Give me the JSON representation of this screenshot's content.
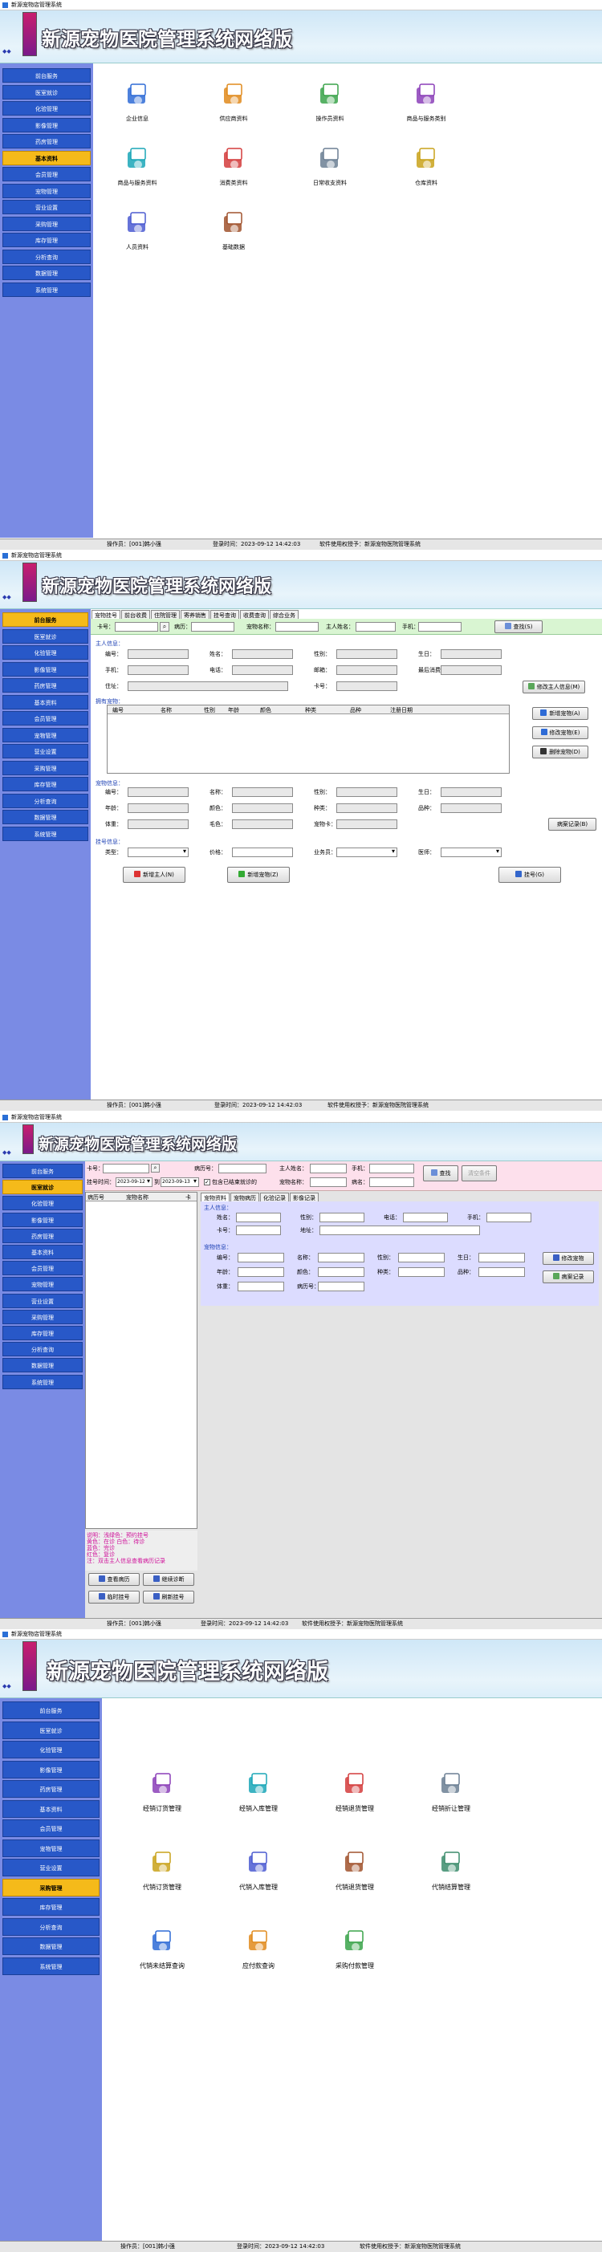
{
  "app": {
    "window_title": "新源宠物店管理系统",
    "banner_title": "新源宠物医院管理系统网络版",
    "banner_mini": "◆◆"
  },
  "status": {
    "operator": "操作员：[001]韩小强",
    "login_time": "登录时间：2023-09-12 14:42:03",
    "licensee": "软件使用权授予：新源宠物医院管理系统"
  },
  "menu": [
    "前台服务",
    "医室就诊",
    "化验管理",
    "影像管理",
    "药房管理",
    "基本资料",
    "会员管理",
    "宠物管理",
    "营业设置",
    "采购管理",
    "库存管理",
    "分析查询",
    "数据管理",
    "系统管理"
  ],
  "panel1": {
    "active_menu": "基本资料",
    "tiles": [
      {
        "label": "企业信息",
        "icon": "company-info-icon"
      },
      {
        "label": "供应商资料",
        "icon": "supplier-icon"
      },
      {
        "label": "操作员资料",
        "icon": "operator-icon"
      },
      {
        "label": "商品与服务类别",
        "icon": "category-icon"
      },
      {
        "label": "商品与服务资料",
        "icon": "goods-icon"
      },
      {
        "label": "消费类资料",
        "icon": "consumption-icon"
      },
      {
        "label": "日常收支资料",
        "icon": "income-expense-icon"
      },
      {
        "label": "仓库资料",
        "icon": "warehouse-icon"
      },
      {
        "label": "人员资料",
        "icon": "staff-icon"
      },
      {
        "label": "基础数据",
        "icon": "base-data-icon"
      }
    ]
  },
  "panel2": {
    "active_menu": "前台服务",
    "tabs": [
      "宠物挂号",
      "前台收费",
      "住院管理",
      "寄养销售",
      "挂号查询",
      "收费查询",
      "综合业务"
    ],
    "search": {
      "card_label": "卡号：",
      "pet_no_label": "病历：",
      "pet_name_label": "宠物名称：",
      "owner_label": "主人姓名：",
      "phone_label": "手机：",
      "search_btn": "查找(S)"
    },
    "owner_section": "主人信息：",
    "owner_fields": [
      [
        "编号：",
        "姓名：",
        "性别：",
        "生日："
      ],
      [
        "手机：",
        "电话：",
        "邮箱：",
        "最后消费："
      ],
      [
        "住址：",
        "",
        "卡号："
      ]
    ],
    "modify_owner_btn": "修改主人信息(M)",
    "pets_section": "拥有宠物：",
    "pets_columns": [
      "编号",
      "名称",
      "性别",
      "年龄",
      "颜色",
      "种类",
      "品种",
      "注册日期"
    ],
    "pet_buttons": [
      "新增宠物(A)",
      "修改宠物(E)",
      "删除宠物(D)"
    ],
    "pet_section": "宠物信息：",
    "pet_fields": [
      [
        "编号：",
        "名称：",
        "性别：",
        "生日："
      ],
      [
        "年龄：",
        "颜色：",
        "种类：",
        "品种："
      ],
      [
        "体重：",
        "毛色：",
        "宠物卡："
      ]
    ],
    "medical_btn": "病案记录(B)",
    "reg_section": "挂号信息：",
    "reg_fields": [
      "类型：",
      "价格：",
      "业务员：",
      "医师："
    ],
    "bottom_buttons": [
      "新增主人(N)",
      "新增宠物(Z)",
      "挂号(G)"
    ]
  },
  "panel3": {
    "active_menu": "医室就诊",
    "row1": {
      "card": "卡号：",
      "pet_no": "病历号：",
      "owner": "主人姓名：",
      "phone": "手机：",
      "search_btn": "查找",
      "extra_btn": "清空条件"
    },
    "row2": {
      "date_label": "挂号时间：",
      "date_from": "2023-09-12",
      "to": "到",
      "date_to": "2023-09-13",
      "include": "包含已结束就诊的",
      "pet_name": "宠物名称：",
      "vip": "病名："
    },
    "list_columns": [
      "病历号",
      "宠物名称",
      "卡"
    ],
    "legend_lines": [
      "说明：浅绿色：预约挂号",
      "黄色：在诊    白色：待诊",
      "蓝色：完诊",
      "红色：复诊",
      "注：双击主人信息查看病历记录"
    ],
    "left_buttons": [
      "查看病历",
      "继续诊断",
      "临时挂号",
      "刷新挂号"
    ],
    "tabs": [
      "宠物资料",
      "宠物病历",
      "化验记录",
      "影像记录"
    ],
    "owner_section": "主人信息：",
    "owner_fields": [
      "姓名：",
      "性别：",
      "电话：",
      "手机：",
      "卡号：",
      "地址："
    ],
    "pet_section": "宠物信息：",
    "pet_fields": [
      [
        "编号：",
        "名称：",
        "性别：",
        "生日："
      ],
      [
        "年龄：",
        "颜色：",
        "种类：",
        "品种："
      ],
      [
        "体重：",
        "病历号："
      ]
    ],
    "modify_btn": "修改宠物",
    "record_btn": "病案记录"
  },
  "panel4": {
    "active_menu": "采购管理",
    "tiles": [
      {
        "label": "经销订货管理",
        "icon": "order-pen-icon"
      },
      {
        "label": "经销入库管理",
        "icon": "stock-in-icon"
      },
      {
        "label": "经销退货管理",
        "icon": "return-goods-icon"
      },
      {
        "label": "经销折让管理",
        "icon": "discount-icon"
      },
      {
        "label": "代销订货管理",
        "icon": "consign-order-icon"
      },
      {
        "label": "代销入库管理",
        "icon": "consign-in-icon"
      },
      {
        "label": "代销退货管理",
        "icon": "consign-return-icon"
      },
      {
        "label": "代销结算管理",
        "icon": "consign-settle-icon"
      },
      {
        "label": "代销未结算查询",
        "icon": "unsettled-query-icon"
      },
      {
        "label": "应付款查询",
        "icon": "payable-icon"
      },
      {
        "label": "采购付款管理",
        "icon": "payment-db-icon"
      }
    ]
  }
}
